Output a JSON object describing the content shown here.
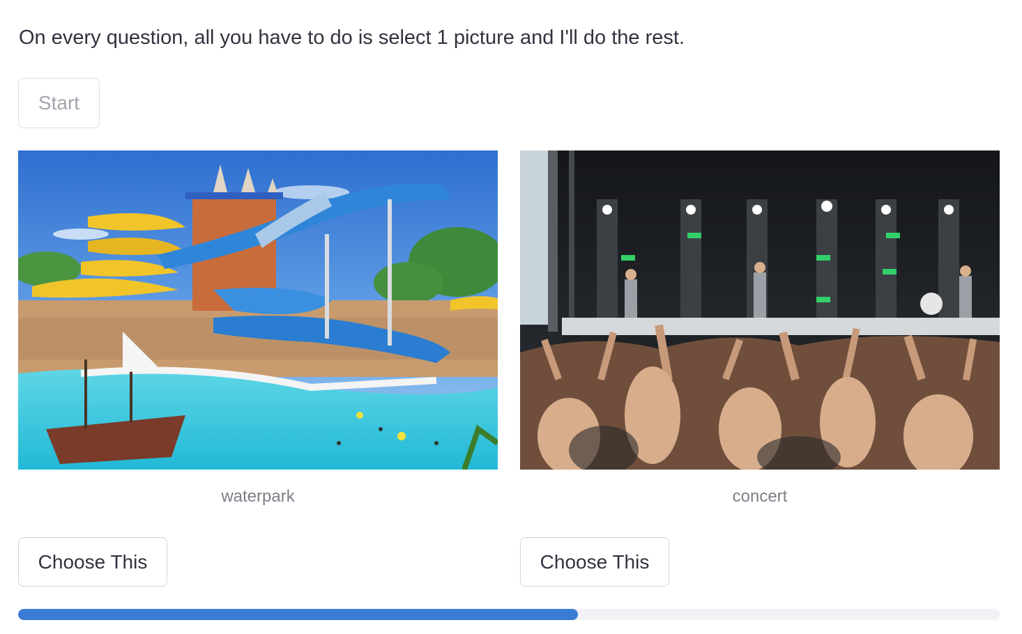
{
  "intro_text": "On every question, all you have to do is select 1 picture and I'll do the rest.",
  "start_button": {
    "label": "Start",
    "disabled": true
  },
  "options": [
    {
      "caption": "waterpark",
      "button_label": "Choose This",
      "image_icon": "waterpark-photo"
    },
    {
      "caption": "concert",
      "button_label": "Choose This",
      "image_icon": "concert-photo"
    }
  ],
  "progress": {
    "fraction": 0.57
  },
  "colors": {
    "accent": "#3a7bd5",
    "track": "#f0f2f6",
    "text": "#31333f",
    "muted_text": "#7d7f88"
  }
}
